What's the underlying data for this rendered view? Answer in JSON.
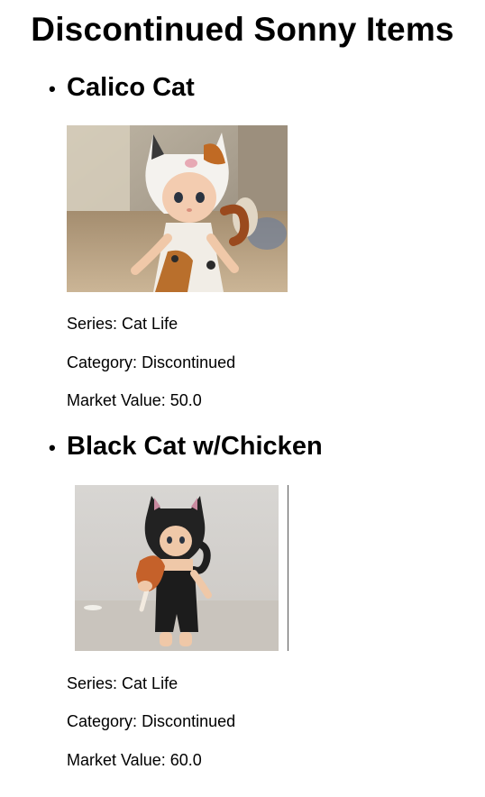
{
  "page": {
    "title": "Discontinued Sonny Items"
  },
  "items": [
    {
      "name": "Calico Cat",
      "image_alt": "Calico Cat figure photo",
      "series_label": "Series:",
      "series": "Cat Life",
      "category_label": "Category:",
      "category": "Discontinued",
      "market_value_label": "Market Value:",
      "market_value": "50.0"
    },
    {
      "name": "Black Cat w/Chicken",
      "image_alt": "Black Cat w/Chicken figure photo",
      "series_label": "Series:",
      "series": "Cat Life",
      "category_label": "Category:",
      "category": "Discontinued",
      "market_value_label": "Market Value:",
      "market_value": "60.0"
    }
  ]
}
